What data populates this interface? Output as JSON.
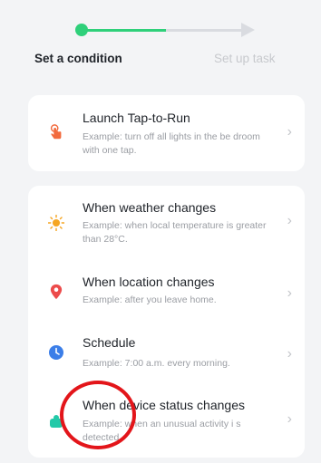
{
  "stepper": {
    "step1_label": "Set a condition",
    "step2_label": "Set up task",
    "active_color": "#2fd07a",
    "inactive_color": "#d9dbe0"
  },
  "tap_to_run": {
    "title": "Launch Tap-to-Run",
    "desc": "Example: turn off all lights in the be droom with one tap.",
    "icon": "hand-tap-icon"
  },
  "conditions": [
    {
      "title": "When weather changes",
      "desc": "Example: when local temperature is greater than 28°C.",
      "icon": "sun-icon"
    },
    {
      "title": "When location changes",
      "desc": "Example: after you leave home.",
      "icon": "location-pin-icon"
    },
    {
      "title": "Schedule",
      "desc": "Example: 7:00 a.m. every morning.",
      "icon": "clock-icon"
    },
    {
      "title": "When device status changes",
      "desc": "Example: when an unusual activity i s detected.",
      "icon": "device-icon"
    }
  ],
  "annotation": {
    "color": "#e3151a"
  }
}
